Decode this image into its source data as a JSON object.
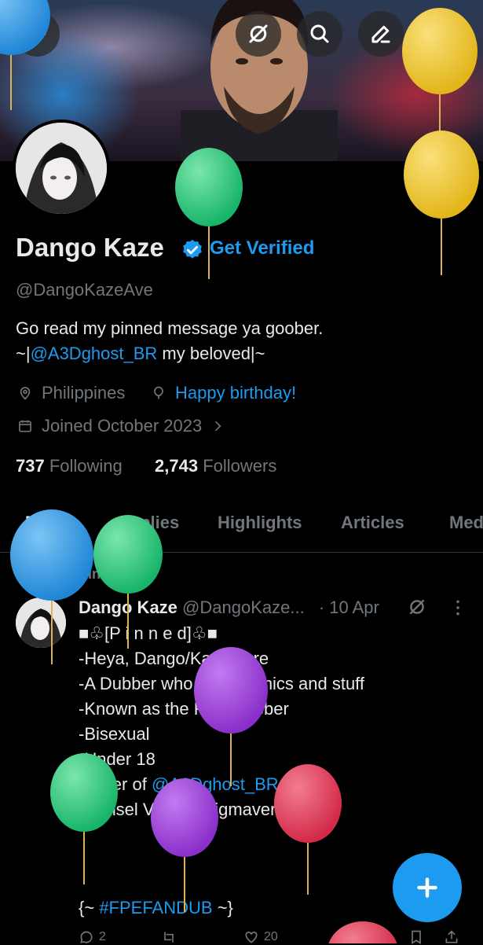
{
  "header": {
    "back_icon": "arrow-left-icon",
    "buttons": [
      "no-notification-icon",
      "search-icon",
      "edit-icon",
      "more-vertical-icon"
    ]
  },
  "profile": {
    "name": "Dango Kaze",
    "verified_badge": "verified-icon",
    "get_verified_label": "Get Verified",
    "handle": "@DangoKazeAve",
    "bio_line1": "Go read my pinned message ya goober.",
    "bio_line2_prefix": "~|",
    "bio_line2_mention": "@A3Dghost_BR",
    "bio_line2_suffix": " my beloved|~",
    "location": "Philippines",
    "birthday": "Happy birthday!",
    "joined": "Joined October 2023",
    "following_count": "737",
    "following_label": "Following",
    "followers_count": "2,743",
    "followers_label": "Followers"
  },
  "tabs": [
    "Posts",
    "Replies",
    "Highlights",
    "Articles",
    "Med"
  ],
  "post": {
    "pinned_label": "Pinned",
    "author": "Dango Kaze",
    "handle": "@DangoKaze...",
    "date": "· 10 Apr",
    "line1": "■♧[P i n n e d]♧■",
    "line2": "-Heya, Dango/Kaze here",
    "line3": "-A Dubber who dubs comics and stuff",
    "line4": "-Known as the FPE Dubber",
    "line5": "-Bisexual",
    "line6": "-Under 18",
    "line7_prefix": "-Lover of ",
    "line7_mention": "@A3Dghost_BR",
    "line8": "-Hansel VA for Enigmaverse",
    "line9": "{~ ",
    "hashtag": "#FPEFANDUB",
    "line9_suffix": " ~}",
    "reply_count": "2",
    "like_count": "20"
  },
  "fab_icon": "plus-icon",
  "colors": {
    "accent": "#1d9bf0",
    "muted": "#71767b",
    "text": "#e7e9ea",
    "background": "#000000"
  }
}
